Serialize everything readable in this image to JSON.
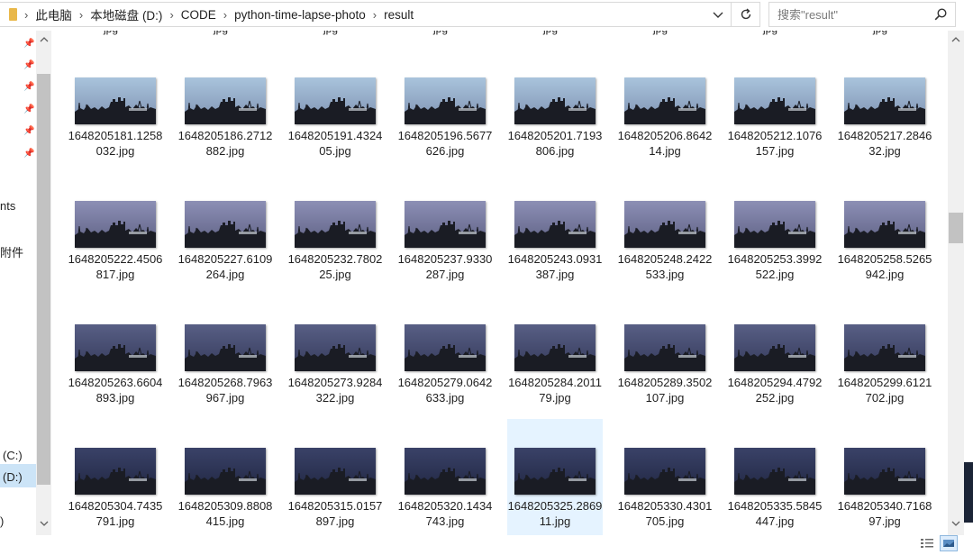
{
  "address_bar": {
    "crumbs": [
      "此电脑",
      "本地磁盘 (D:)",
      "CODE",
      "python-time-lapse-photo",
      "result"
    ]
  },
  "search": {
    "placeholder": "搜索\"result\""
  },
  "nav": {
    "labels": [
      "nts",
      "附件",
      "(C:)",
      "(D:)",
      ")"
    ]
  },
  "files": {
    "cutoff_label": "jpg",
    "rows": [
      [
        "1648205181.1258032.jpg",
        "1648205186.2712882.jpg",
        "1648205191.432405.jpg",
        "1648205196.5677626.jpg",
        "1648205201.7193806.jpg",
        "1648205206.864214.jpg",
        "1648205212.1076157.jpg",
        "1648205217.284632.jpg"
      ],
      [
        "1648205222.4506817.jpg",
        "1648205227.6109264.jpg",
        "1648205232.780225.jpg",
        "1648205237.9330287.jpg",
        "1648205243.0931387.jpg",
        "1648205248.2422533.jpg",
        "1648205253.3992522.jpg",
        "1648205258.5265942.jpg"
      ],
      [
        "1648205263.6604893.jpg",
        "1648205268.7963967.jpg",
        "1648205273.9284322.jpg",
        "1648205279.0642633.jpg",
        "1648205284.201179.jpg",
        "1648205289.3502107.jpg",
        "1648205294.4792252.jpg",
        "1648205299.6121702.jpg"
      ],
      [
        "1648205304.7435791.jpg",
        "1648205309.8808415.jpg",
        "1648205315.0157897.jpg",
        "1648205320.1434743.jpg",
        "1648205325.286911.jpg",
        "1648205330.4301705.jpg",
        "1648205335.5845447.jpg",
        "1648205340.716897.jpg"
      ]
    ],
    "selected": "1648205325.286911.jpg"
  },
  "colors": {
    "accent": "#cce4f7",
    "selected_tile": "#e5f3ff",
    "sky_rows": [
      [
        "#a9c4dc",
        "#7d8fb0"
      ],
      [
        "#8c8fb5",
        "#5d5f82"
      ],
      [
        "#585f85",
        "#34395a"
      ],
      [
        "#3a4268",
        "#1f2540"
      ]
    ]
  }
}
